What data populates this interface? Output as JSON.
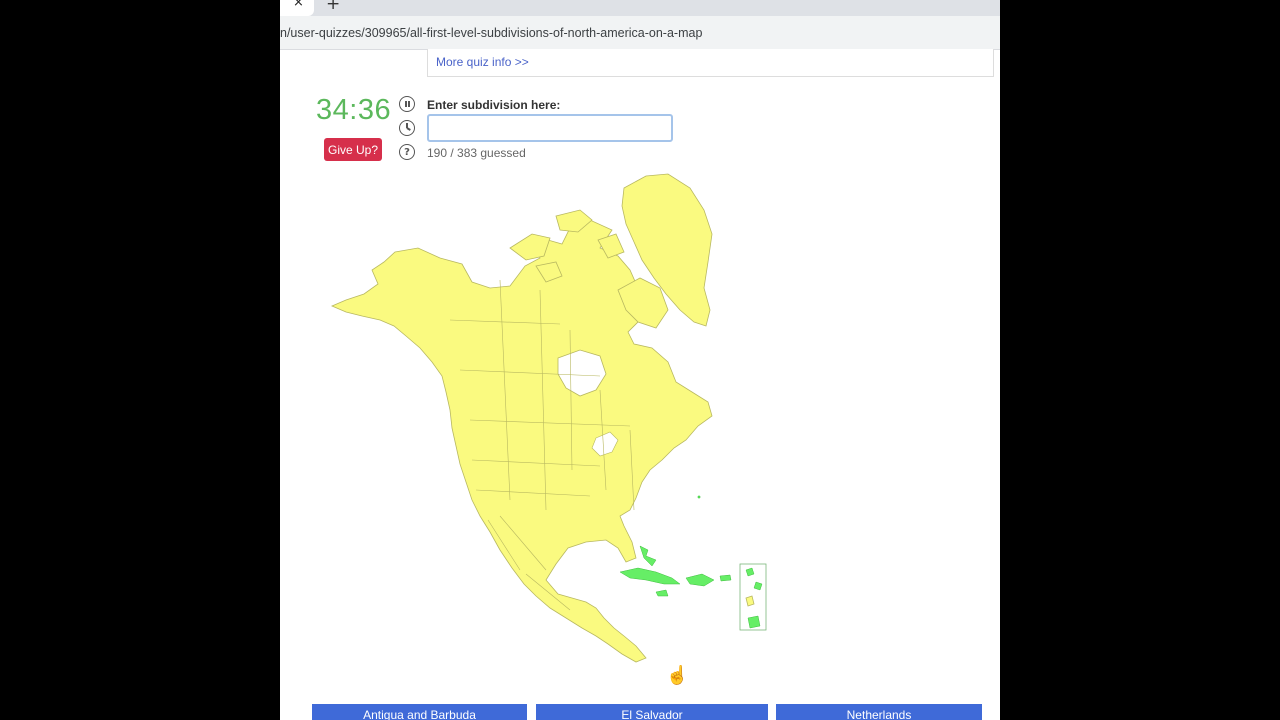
{
  "browser": {
    "url": "n/user-quizzes/309965/all-first-level-subdivisions-of-north-america-on-a-map",
    "tab_close_glyph": "×",
    "new_tab_glyph": "+"
  },
  "quiz": {
    "more_info_link": "More quiz info >>",
    "timer": "34:36",
    "give_up_label": "Give Up?",
    "input_label": "Enter subdivision here:",
    "input_value": "",
    "guessed_text": "190 / 383 guessed"
  },
  "icons": {
    "pause": "pause-icon",
    "clock": "clock-icon",
    "help": "help-icon",
    "help_glyph": "?",
    "cursor": "hand-cursor-icon",
    "cursor_glyph": "☝"
  },
  "map": {
    "land_color": "#fafa80",
    "border_color": "#b8b860",
    "guessed_color": "#66ee66"
  },
  "choices": [
    "Antigua and Barbuda",
    "El Salvador",
    "Netherlands"
  ],
  "colors": {
    "timer": "#5cb85c",
    "give_up_bg": "#d62f4b",
    "choice_bg": "#3f6ad8",
    "link": "#4a63c9"
  }
}
